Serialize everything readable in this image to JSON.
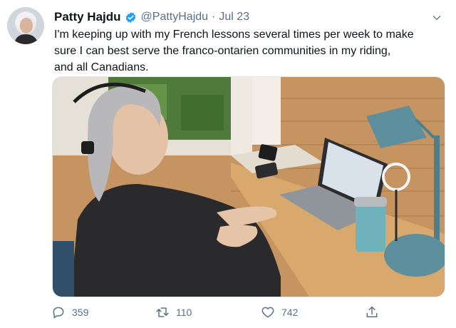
{
  "tweet": {
    "author_name": "Patty Hajdu",
    "handle": "@PattyHajdu",
    "separator": "·",
    "date": "Jul 23",
    "text_lines": [
      "I'm keeping up with my French lessons several times per week to make",
      "sure I can best serve the franco-ontarien communities in my riding,",
      "and all Canadians."
    ]
  },
  "icons": {
    "avatar": "profile-photo",
    "verified": "verified-badge-icon",
    "more": "chevron-down-icon",
    "reply": "reply-icon",
    "retweet": "retweet-icon",
    "like": "heart-icon",
    "share": "share-icon"
  },
  "actions": {
    "replies": "359",
    "retweets": "110",
    "likes": "742"
  },
  "colors": {
    "verified_blue": "#1da1f2",
    "secondary_text": "#5b7083"
  }
}
